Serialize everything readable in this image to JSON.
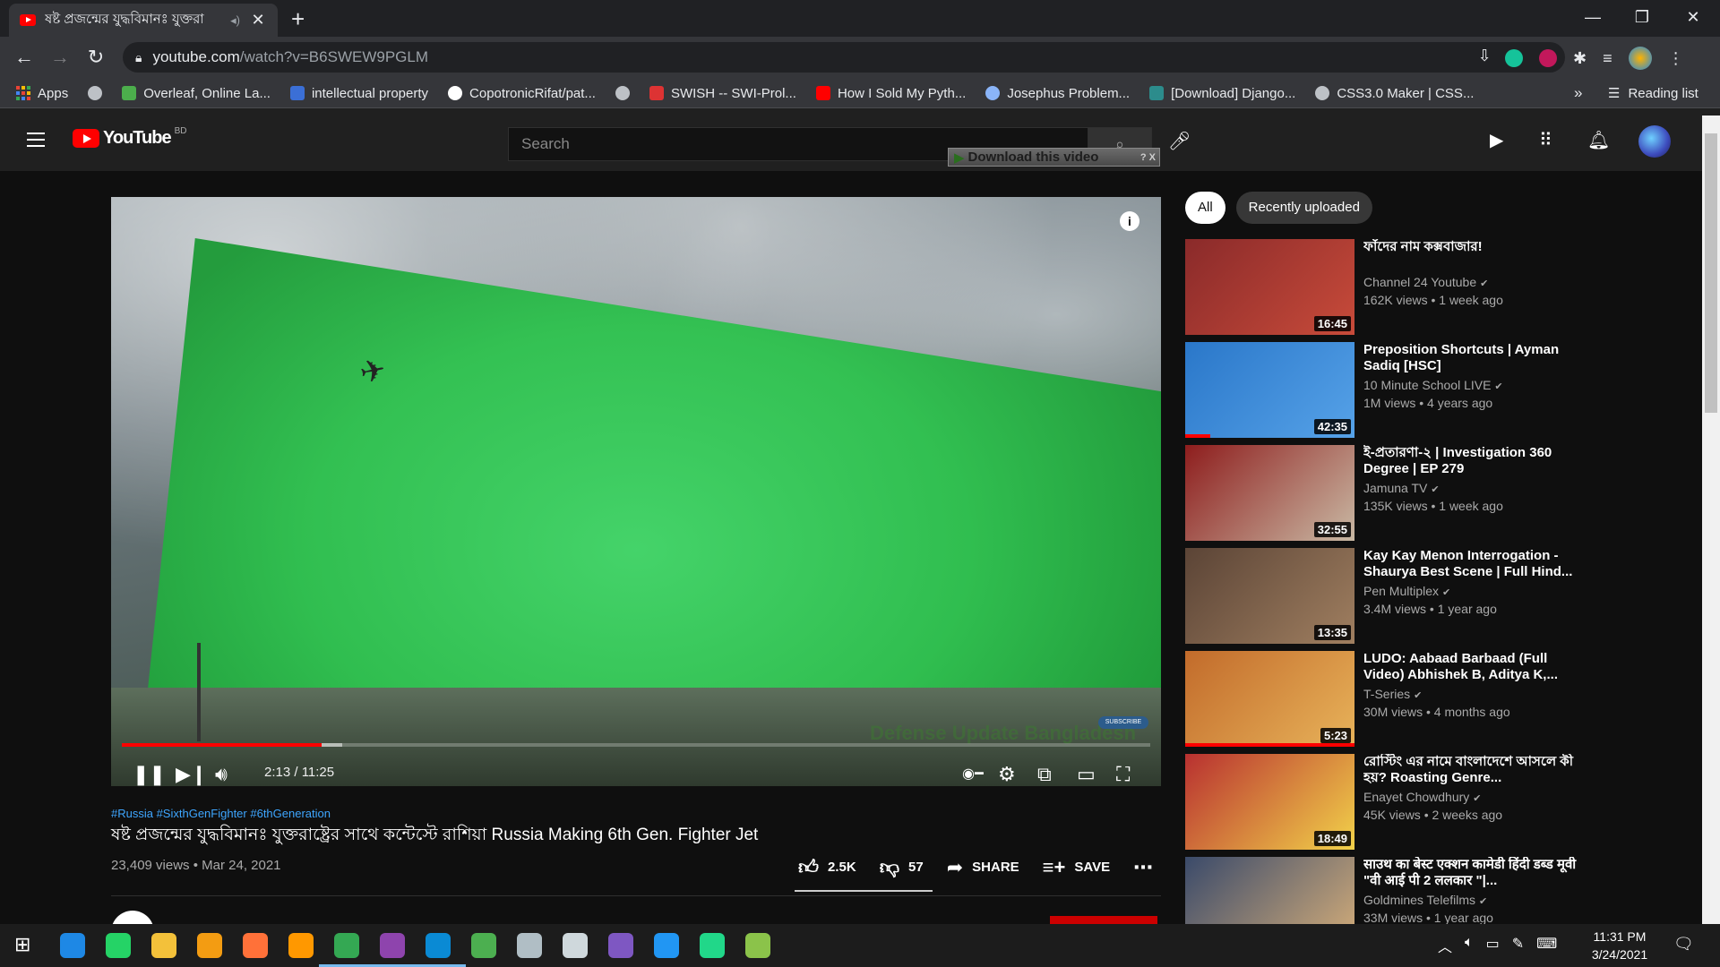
{
  "browser": {
    "tab_title": "ষষ্ট প্রজন্মের যুদ্ধবিমানঃ যুক্তরা",
    "url_host": "youtube.com",
    "url_path": "/watch?v=B6SWEW9PGLM",
    "bookmarks": [
      {
        "label": "Apps",
        "icon": "apps-icon",
        "color": "#ea4335"
      },
      {
        "label": "",
        "icon": "globe-icon",
        "color": "#bdc1c6"
      },
      {
        "label": "Overleaf, Online La...",
        "icon": "overleaf-icon",
        "color": "#4cae4c"
      },
      {
        "label": "intellectual property",
        "icon": "bookmark-s-icon",
        "color": "#3b6fd6"
      },
      {
        "label": "CopotronicRifat/pat...",
        "icon": "github-icon",
        "color": "#ffffff"
      },
      {
        "label": "",
        "icon": "globe-icon",
        "color": "#bdc1c6"
      },
      {
        "label": "SWISH -- SWI-Prol...",
        "icon": "swish-icon",
        "color": "#d33"
      },
      {
        "label": "How I Sold My Pyth...",
        "icon": "youtube-icon",
        "color": "#ff0000"
      },
      {
        "label": "Josephus Problem...",
        "icon": "loading-icon",
        "color": "#8ab4f8"
      },
      {
        "label": "[Download] Django...",
        "icon": "django-icon",
        "color": "#2c8c8c"
      },
      {
        "label": "CSS3.0 Maker | CSS...",
        "icon": "globe-icon",
        "color": "#bdc1c6"
      }
    ],
    "bookmarks_more": "»",
    "reading_list": "Reading list"
  },
  "youtube": {
    "logo_text": "YouTube",
    "country": "BD",
    "search_placeholder": "Search",
    "download_overlay": "Download this video",
    "download_overlay_help": "? X"
  },
  "player": {
    "current_time": "2:13",
    "duration": "11:25",
    "time_display": "2:13 / 11:25",
    "played_fraction": 0.194,
    "buffered_fraction": 0.214,
    "watermark": "Defense Update Bangladesh",
    "subscribe_watermark": "SUBSCRIBE"
  },
  "video": {
    "hashtags": "#Russia #SixthGenFighter #6thGeneration",
    "title": "ষষ্ট প্রজন্মের যুদ্ধবিমানঃ যুক্তরাষ্ট্রের সাথে কন্টেস্টে রাশিয়া Russia Making 6th Gen. Fighter Jet",
    "view_info": "23,409 views • Mar 24, 2021",
    "likes": "2.5K",
    "dislikes": "57",
    "share_label": "SHARE",
    "save_label": "SAVE"
  },
  "sidebar": {
    "chips": [
      "All",
      "Recently uploaded"
    ],
    "recommendations": [
      {
        "title": "ফাঁদের নাম কক্সবাজার!",
        "channel": "Channel 24 Youtube",
        "meta": "162K views • 1 week ago",
        "duration": "16:45",
        "thumb_colors": [
          "#8a2a2a",
          "#c84b3a"
        ],
        "watched_fraction": 0
      },
      {
        "title": "Preposition Shortcuts | Ayman Sadiq [HSC]",
        "channel": "10 Minute School LIVE",
        "meta": "1M views • 4 years ago",
        "duration": "42:35",
        "thumb_colors": [
          "#2a77c9",
          "#56a2e8"
        ],
        "watched_fraction": 0.15
      },
      {
        "title": "ই-প্রতারণা-২ | Investigation 360 Degree | EP 279",
        "channel": "Jamuna TV",
        "meta": "135K views • 1 week ago",
        "duration": "32:55",
        "thumb_colors": [
          "#8e1d1d",
          "#c9b9a4"
        ],
        "watched_fraction": 0
      },
      {
        "title": "Kay Kay Menon Interrogation - Shaurya Best Scene | Full Hind...",
        "channel": "Pen Multiplex",
        "meta": "3.4M views • 1 year ago",
        "duration": "13:35",
        "thumb_colors": [
          "#5b4436",
          "#a07f60"
        ],
        "watched_fraction": 0
      },
      {
        "title": "LUDO: Aabaad Barbaad (Full Video) Abhishek B, Aditya K,...",
        "channel": "T-Series",
        "meta": "30M views • 4 months ago",
        "duration": "5:23",
        "thumb_colors": [
          "#c26b2b",
          "#e8b35a"
        ],
        "watched_fraction": 1
      },
      {
        "title": "রোস্টিং এর নামে বাংলাদেশে আসলে কী হয়? Roasting Genre...",
        "channel": "Enayet Chowdhury",
        "meta": "45K views • 2 weeks ago",
        "duration": "18:49",
        "thumb_colors": [
          "#b83030",
          "#f2d24a"
        ],
        "watched_fraction": 0
      },
      {
        "title": "साउथ का बेस्ट एक्शन कामेडी हिंदी डब्ड मूवी \"वी आई पी 2 ललकार \"|...",
        "channel": "Goldmines Telefilms",
        "meta": "33M views • 1 year ago",
        "duration": "",
        "thumb_colors": [
          "#3a4a6a",
          "#d8b07a"
        ],
        "watched_fraction": 0
      }
    ]
  },
  "taskbar": {
    "time": "11:31 PM",
    "date": "3/24/2021",
    "apps": [
      {
        "name": "windows-start-icon",
        "color": "#ffffff"
      },
      {
        "name": "search-app-icon",
        "color": "#1e88e5"
      },
      {
        "name": "whatsapp-icon",
        "color": "#25d366"
      },
      {
        "name": "file-explorer-icon",
        "color": "#f3c13a"
      },
      {
        "name": "vpn-icon",
        "color": "#f39c12"
      },
      {
        "name": "firefox-icon",
        "color": "#ff7139"
      },
      {
        "name": "sublime-icon",
        "color": "#ff9800"
      },
      {
        "name": "chrome-icon",
        "color": "#34a853"
      },
      {
        "name": "github-desktop-icon",
        "color": "#8e44ad"
      },
      {
        "name": "vscode-icon",
        "color": "#0a8ad4"
      },
      {
        "name": "app-globe-icon",
        "color": "#4caf50"
      },
      {
        "name": "app-parachute-icon",
        "color": "#b0bec5"
      },
      {
        "name": "app-satellite-icon",
        "color": "#cfd8dc"
      },
      {
        "name": "visual-studio-icon",
        "color": "#7e57c2"
      },
      {
        "name": "messenger-icon",
        "color": "#2196f3"
      },
      {
        "name": "pycharm-icon",
        "color": "#21d789"
      },
      {
        "name": "notepad-icon",
        "color": "#8bc34a"
      }
    ]
  }
}
